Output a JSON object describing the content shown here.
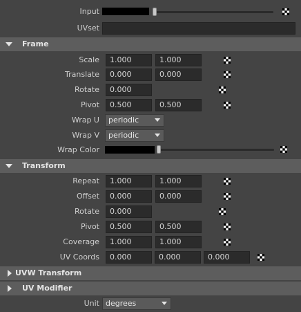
{
  "top": {
    "input_label": "Input",
    "uvset_label": "UVset",
    "uvset_value": ""
  },
  "frame": {
    "title": "Frame",
    "scale_label": "Scale",
    "scale_u": "1.000",
    "scale_v": "1.000",
    "translate_label": "Translate",
    "translate_u": "0.000",
    "translate_v": "0.000",
    "rotate_label": "Rotate",
    "rotate_value": "0.000",
    "pivot_label": "Pivot",
    "pivot_u": "0.500",
    "pivot_v": "0.500",
    "wrap_u_label": "Wrap U",
    "wrap_u_value": "periodic",
    "wrap_v_label": "Wrap V",
    "wrap_v_value": "periodic",
    "wrap_color_label": "Wrap Color"
  },
  "transform": {
    "title": "Transform",
    "repeat_label": "Repeat",
    "repeat_u": "1.000",
    "repeat_v": "1.000",
    "offset_label": "Offset",
    "offset_u": "0.000",
    "offset_v": "0.000",
    "rotate_label": "Rotate",
    "rotate_value": "0.000",
    "pivot_label": "Pivot",
    "pivot_u": "0.500",
    "pivot_v": "0.500",
    "coverage_label": "Coverage",
    "coverage_u": "1.000",
    "coverage_v": "1.000",
    "uvcoords_label": "UV Coords",
    "uvcoords_u": "0.000",
    "uvcoords_v": "0.000",
    "uvcoords_w": "0.000"
  },
  "uvw_transform": {
    "title": "UVW Transform"
  },
  "uv_modifier": {
    "title": "UV Modifier"
  },
  "unit": {
    "label": "Unit",
    "value": "degrees"
  },
  "colors": {
    "background": "#444444",
    "section_header": "#5d5d5d",
    "field_bg": "#2b2b2b"
  }
}
